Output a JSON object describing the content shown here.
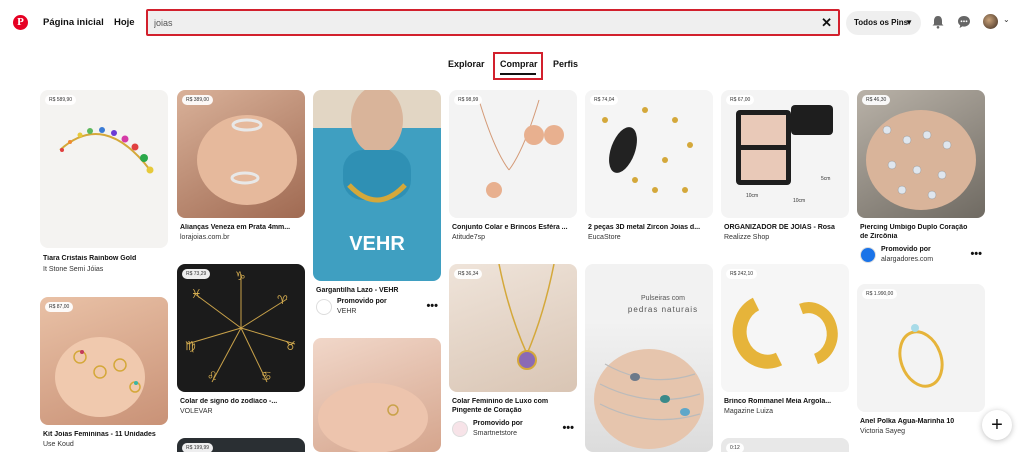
{
  "header": {
    "logo": "P",
    "home": "Página inicial",
    "today": "Hoje",
    "search_value": "joias",
    "filter_label": "Todos os Pins"
  },
  "tabs": [
    "Explorar",
    "Comprar",
    "Perfis"
  ],
  "pins": [
    {
      "price": "R$ 589,90",
      "title": "Tiara Cristais Rainbow Gold",
      "sub": "It Stone Semi Jóias"
    },
    {
      "price": "R$ 87,00",
      "title": "Kit Joias Femininas - 11 Unidades",
      "sub": "Use Koud"
    },
    {
      "price": "R$ 389,00",
      "title": "Alianças Veneza em Prata 4mm...",
      "sub": "lorajoias.com.br"
    },
    {
      "price": "R$ 73,29",
      "title": "Colar de signo do zodíaco -...",
      "sub": "VOLEVAR"
    },
    {
      "price": "R$ 199,99"
    },
    {
      "title": "Gargantilha Lazo - VEHR",
      "promo": "Promovido por",
      "brand": "VEHR",
      "image_text": "VEHR"
    },
    {
      "price": "R$ 98,99",
      "title": "Conjunto Colar e Brincos Esféra ...",
      "sub": "Atitude7sp"
    },
    {
      "price": "R$ 36,34",
      "title": "Colar Feminino de Luxo com",
      "title2": "Pingente de Coração",
      "promo": "Promovido por",
      "brand": "Smartnetstore"
    },
    {
      "price": "R$ 74,04",
      "title": "2 peças 3D metal Zircon Joias d...",
      "sub": "EucaStore"
    },
    {
      "image_line1": "Pulseiras com",
      "image_line2": "pedras naturais"
    },
    {
      "price": "R$ 67,00",
      "title": "ORGANIZADOR DE JOIAS - Rosa",
      "sub": "Realizze Shop",
      "dim1": "5cm",
      "dim2": "10cm",
      "dim3": "10cm"
    },
    {
      "price": "R$ 242,10",
      "title": "Brinco Rommanel Meia Argola...",
      "sub": "Magazine Luiza"
    },
    {
      "price": "R$ 46,30",
      "title": "Piercing Umbigo Duplo Coração",
      "title2": "de Zircônia",
      "promo": "Promovido por",
      "brand": "alargadores.com"
    },
    {
      "price": "R$ 1.990,00",
      "title": "Anel Polka Água-Marinha 10",
      "sub": "Victoria Sayeg"
    },
    {
      "price": "0:12"
    }
  ],
  "colors": {
    "brand_red": "#e60023",
    "highlight_red": "#d2202d"
  }
}
